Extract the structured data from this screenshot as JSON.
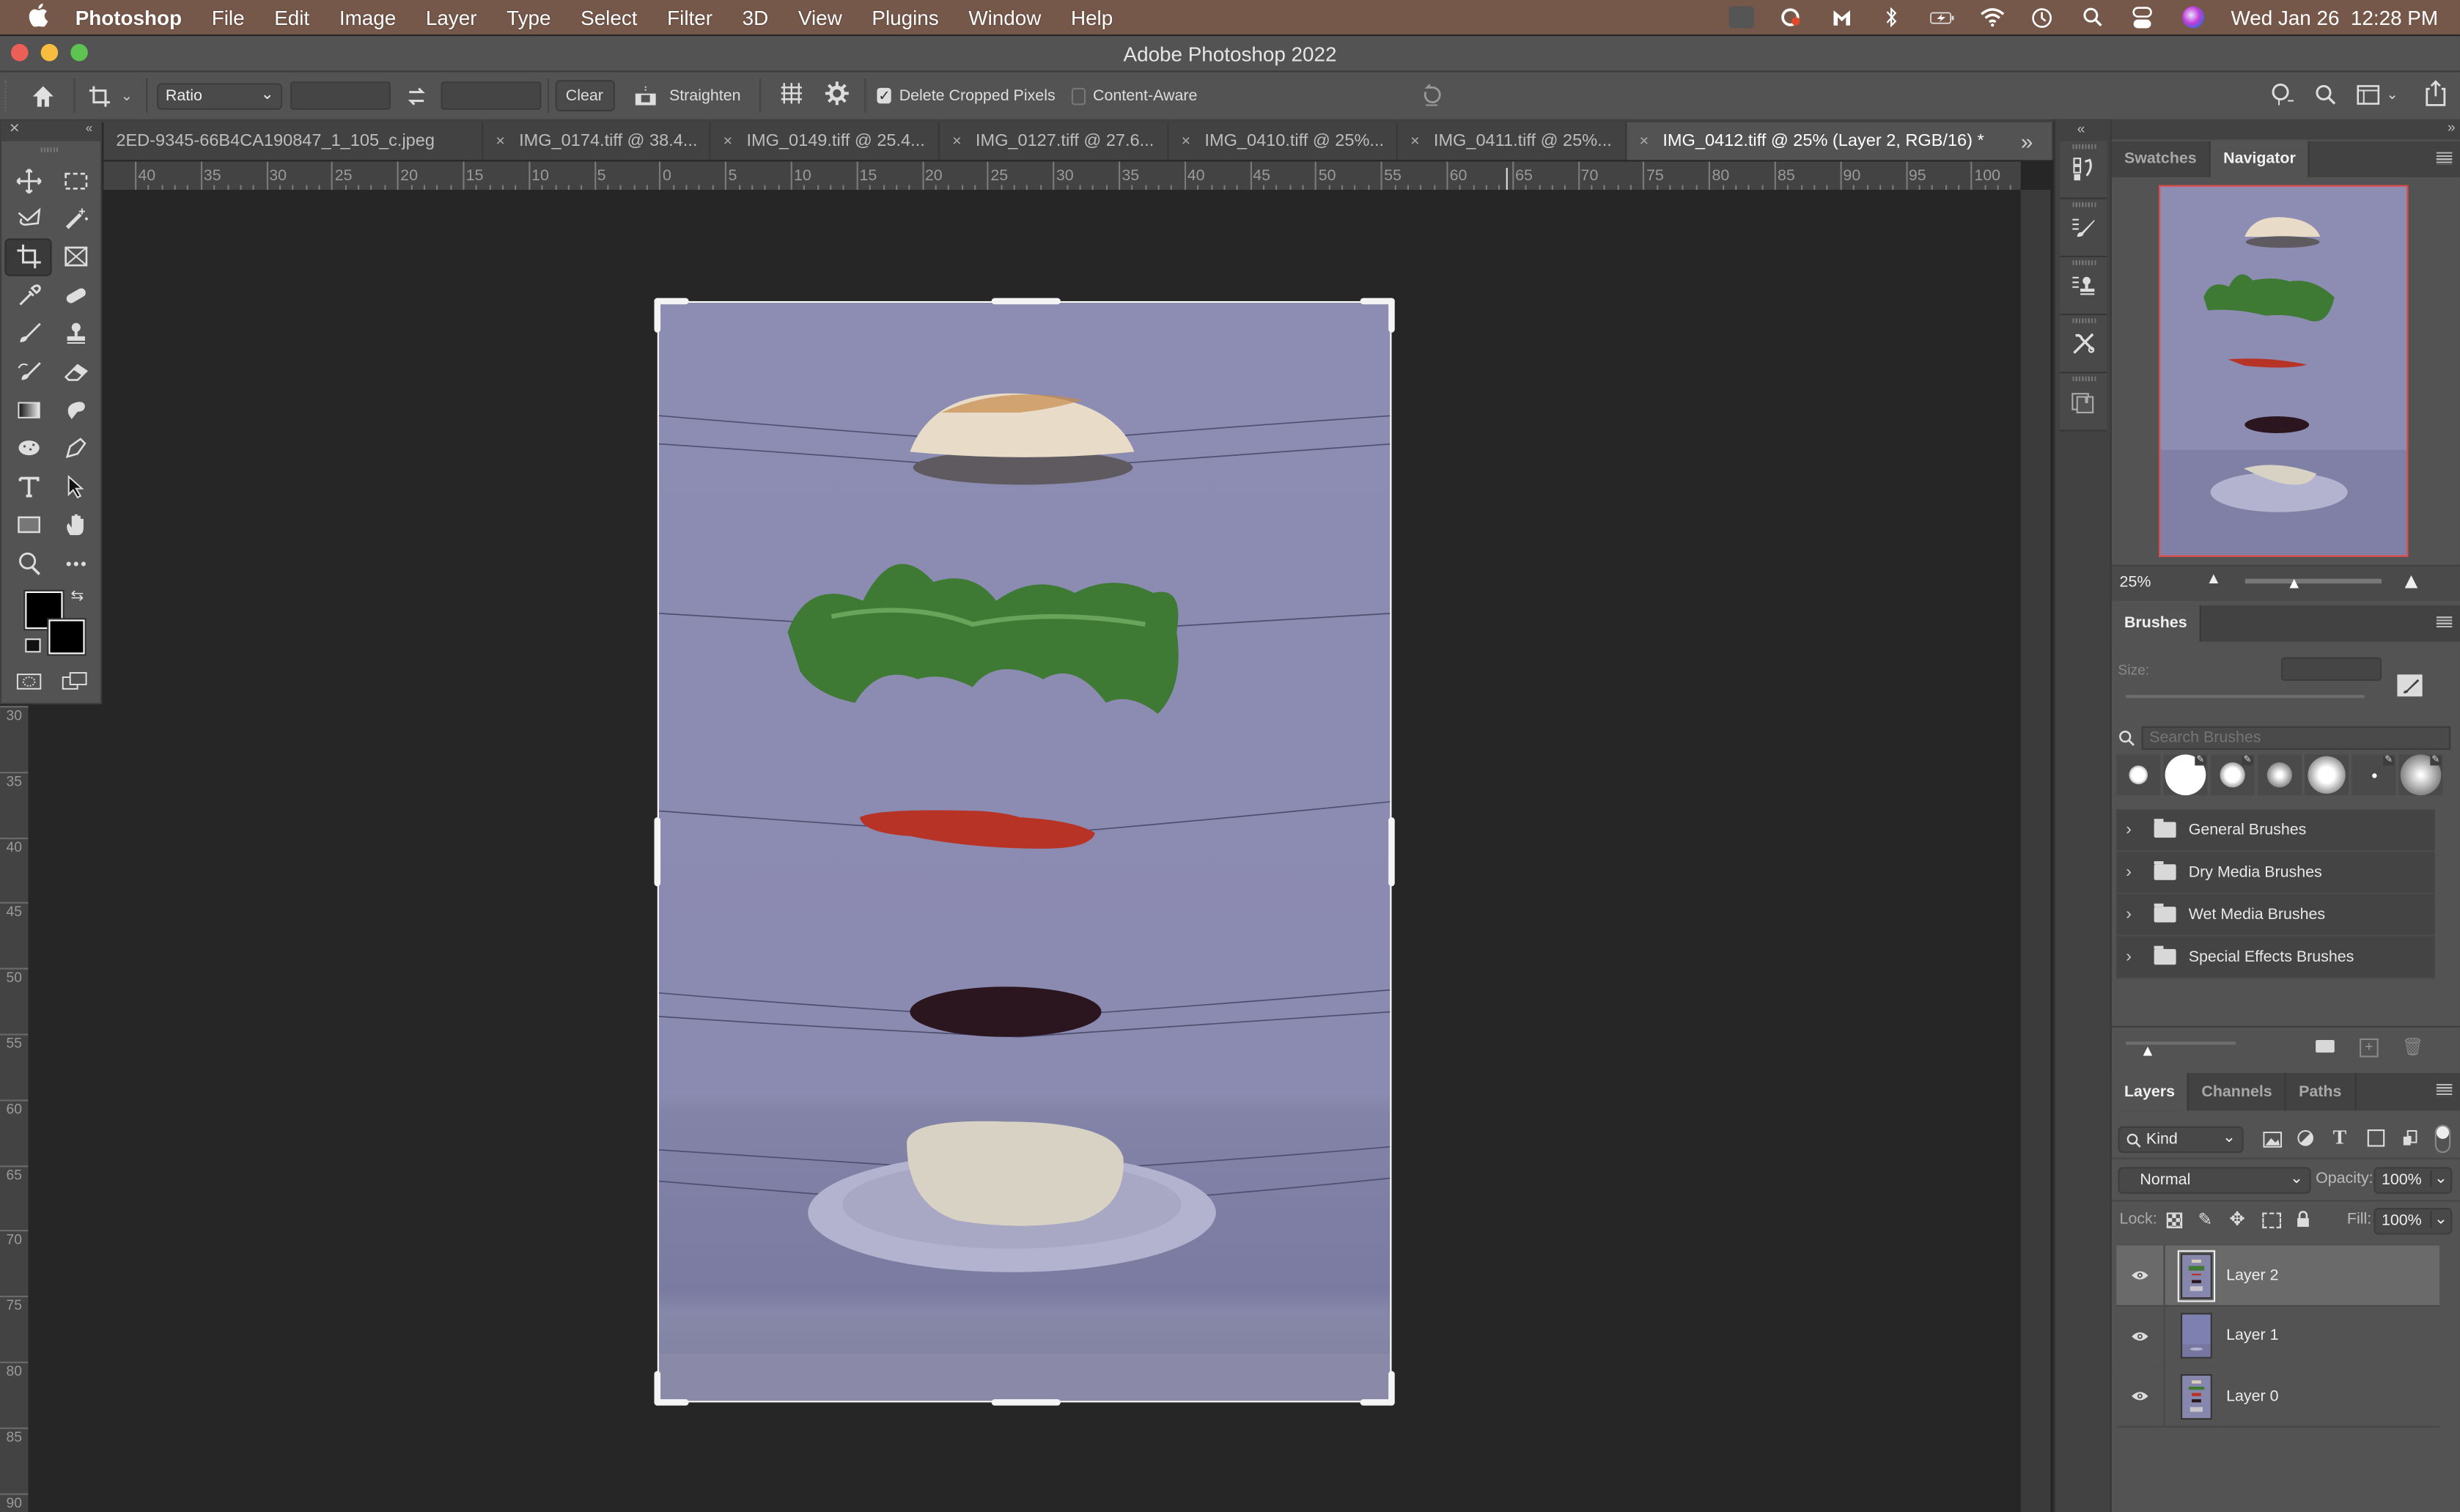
{
  "menubar": {
    "app_name": "Photoshop",
    "items": [
      "File",
      "Edit",
      "Image",
      "Layer",
      "Type",
      "Select",
      "Filter",
      "3D",
      "View",
      "Plugins",
      "Window",
      "Help"
    ],
    "status_icons": [
      "wd-drive-icon",
      "creative-cloud-icon",
      "malwarebytes-icon",
      "bluetooth-icon",
      "battery-charging-icon",
      "wifi-icon",
      "time-machine-icon",
      "spotlight-search-icon",
      "control-center-icon",
      "siri-icon"
    ],
    "clock": "Wed Jan 26  12:28 PM"
  },
  "window": {
    "title": "Adobe Photoshop 2022"
  },
  "options_bar": {
    "ratio_select": "Ratio",
    "width_value": "",
    "height_value": "",
    "clear_label": "Clear",
    "straighten_label": "Straighten",
    "delete_cropped_label": "Delete Cropped Pixels",
    "delete_cropped_checked": true,
    "content_aware_label": "Content-Aware",
    "content_aware_checked": false
  },
  "tabs": [
    {
      "label": "2ED-9345-66B4CA190847_1_105_c.jpeg",
      "active": false
    },
    {
      "label": "IMG_0174.tiff @ 38.4...",
      "active": false
    },
    {
      "label": "IMG_0149.tiff @ 25.4...",
      "active": false
    },
    {
      "label": "IMG_0127.tiff @ 27.6...",
      "active": false
    },
    {
      "label": "IMG_0410.tiff @ 25%...",
      "active": false
    },
    {
      "label": "IMG_0411.tiff @ 25%...",
      "active": false
    },
    {
      "label": "IMG_0412.tiff @ 25% (Layer 2, RGB/16) *",
      "active": true
    }
  ],
  "tab_close_glyph": "×",
  "tab_overflow_glyph": "»",
  "rulers": {
    "horizontal_labels": [
      "40",
      "35",
      "30",
      "25",
      "20",
      "15",
      "10",
      "5",
      "0",
      "5",
      "10",
      "15",
      "20",
      "25",
      "30",
      "35",
      "40",
      "45",
      "50",
      "55",
      "60",
      "65",
      "70",
      "75",
      "80",
      "85",
      "90",
      "95",
      "100"
    ],
    "vertical_labels": [
      "30",
      "35",
      "40",
      "45",
      "50",
      "55",
      "60",
      "65",
      "70",
      "75",
      "80",
      "85",
      "90"
    ]
  },
  "tools": [
    "move-tool",
    "rectangular-marquee-tool",
    "lasso-tool",
    "magic-wand-tool",
    "crop-tool",
    "frame-tool",
    "eyedropper-tool",
    "healing-brush-tool",
    "brush-tool",
    "clone-stamp-tool",
    "history-brush-tool",
    "eraser-tool",
    "gradient-tool",
    "smudge-tool",
    "sponge-tool",
    "pen-tool",
    "type-tool",
    "path-selection-tool",
    "rectangle-tool",
    "hand-tool",
    "zoom-tool",
    "edit-toolbar"
  ],
  "active_tool": "crop-tool",
  "colors": {
    "foreground": "#000000",
    "background": "#000000",
    "navigator_frame": "#e64646",
    "menubar_bg": "#76584a"
  },
  "dock_icons": [
    "history-panel-icon",
    "brush-settings-icon",
    "clone-source-icon",
    "tool-presets-icon",
    "layer-comps-icon"
  ],
  "navigator": {
    "tabs": [
      "Swatches",
      "Navigator"
    ],
    "active_tab": "Navigator",
    "zoom_label": "25%",
    "zoom_slider_fraction": 0.36
  },
  "brushes": {
    "title": "Brushes",
    "size_label": "Size:",
    "size_value": "",
    "search_placeholder": "Search Brushes",
    "presets": [
      "soft-round-small",
      "hard-round-large",
      "soft-round-medium",
      "soft-round-medium-2",
      "soft-round-large",
      "hard-round-tiny",
      "soft-airbrush"
    ],
    "groups": [
      "General Brushes",
      "Dry Media Brushes",
      "Wet Media Brushes",
      "Special Effects Brushes"
    ],
    "preview_size_fraction": 0.2
  },
  "layers_panel": {
    "tabs": [
      "Layers",
      "Channels",
      "Paths"
    ],
    "active_tab": "Layers",
    "filter_kind": "Kind",
    "blend_mode": "Normal",
    "opacity_label": "Opacity:",
    "opacity": "100%",
    "lock_label": "Lock:",
    "fill_label": "Fill:",
    "fill": "100%",
    "layers": [
      {
        "name": "Layer 2",
        "visible": true,
        "selected": true
      },
      {
        "name": "Layer 1",
        "visible": true,
        "selected": false
      },
      {
        "name": "Layer 0",
        "visible": true,
        "selected": false
      }
    ]
  }
}
